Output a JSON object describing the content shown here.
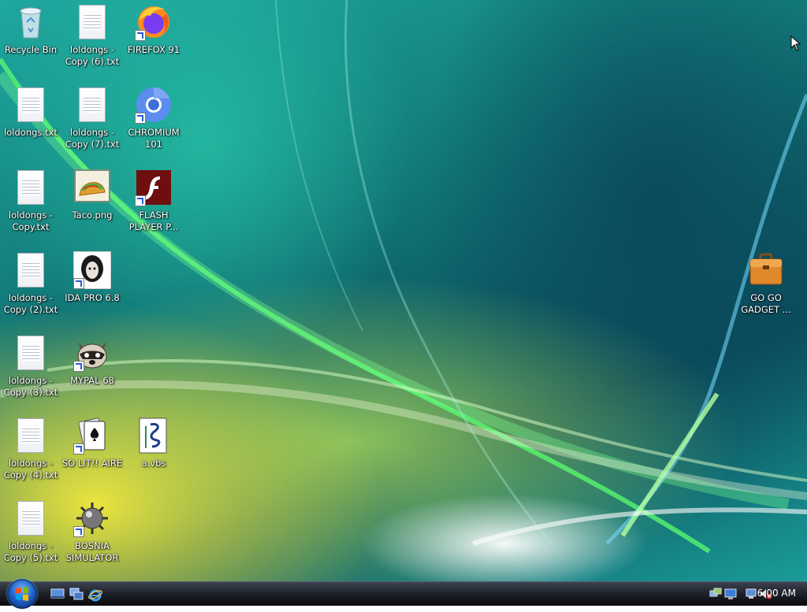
{
  "desktop": {
    "icons": [
      {
        "label": "Recycle Bin"
      },
      {
        "label": "loldongs - Copy (6).txt"
      },
      {
        "label": "FIREFOX 91"
      },
      {
        "label": "loldongs.txt"
      },
      {
        "label": "loldongs - Copy (7).txt"
      },
      {
        "label": "CHROMIUM 101"
      },
      {
        "label": "loldongs - Copy.txt"
      },
      {
        "label": "Taco.png"
      },
      {
        "label": "FLASH PLAYER P..."
      },
      {
        "label": "loldongs - Copy (2).txt"
      },
      {
        "label": "IDA PRO 6.8"
      },
      {
        "label": "loldongs - Copy (3).txt"
      },
      {
        "label": "MYPAL 68"
      },
      {
        "label": "loldongs - Copy (4).txt"
      },
      {
        "label": "SO LIT!! AIRE"
      },
      {
        "label": "a.vbs"
      },
      {
        "label": "loldongs - Copy (5).txt"
      },
      {
        "label": "BOSNIA SIMULATOR"
      },
      {
        "label": "GO GO GADGET ..."
      }
    ]
  },
  "taskbar": {
    "quick_launch": [
      "show-desktop-icon",
      "switch-windows-icon",
      "internet-explorer-icon"
    ],
    "tray_icons": [
      "network-icon",
      "display-icon",
      "volume-muted-icon"
    ],
    "clock": "6:00 AM"
  },
  "colors": {
    "accent": "#1d5bc4",
    "taskbar": "#20242d"
  }
}
